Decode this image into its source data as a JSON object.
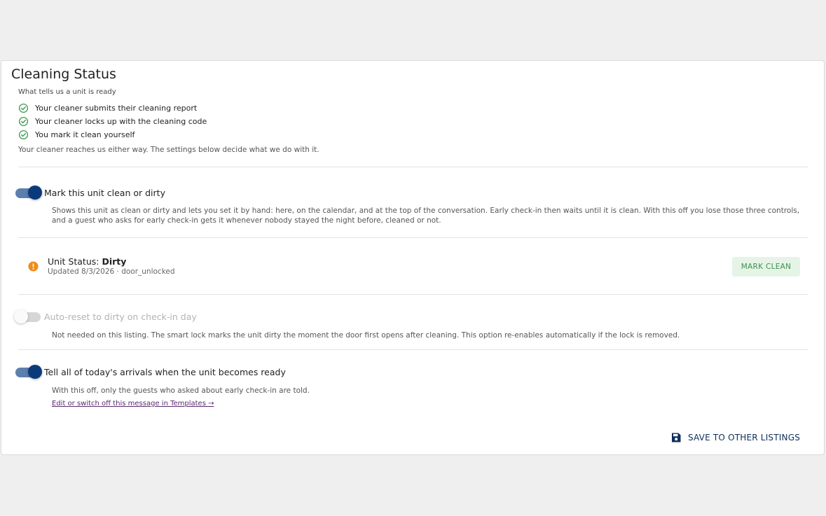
{
  "section": {
    "title": "Cleaning Status",
    "subhead": "What tells us a unit is ready",
    "checks": [
      "Your cleaner submits their cleaning report",
      "Your cleaner locks up with the cleaning code",
      "You mark it clean yourself"
    ],
    "note": "Your cleaner reaches us either way. The settings below decide what we do with it."
  },
  "toggles": {
    "mark_clean": {
      "label": "Mark this unit clean or dirty",
      "on": true,
      "description": "Shows this unit as clean or dirty and lets you set it by hand: here, on the calendar, and at the top of the conversation. Early check-in then waits until it is clean. With this off you lose those three controls, and a guest who asks for early check-in gets it whenever nobody stayed the night before, cleaned or not."
    },
    "auto_reset": {
      "label": "Auto-reset to dirty on check-in day",
      "on": false,
      "disabled": true,
      "description": "Not needed on this listing. The smart lock marks the unit dirty the moment the door first opens after cleaning. This option re-enables automatically if the lock is removed."
    },
    "tell_arrivals": {
      "label": "Tell all of today's arrivals when the unit becomes ready",
      "on": true,
      "description": "With this off, only the guests who asked about early check-in are told.",
      "link": "Edit or switch off this message in Templates →"
    }
  },
  "unit_status": {
    "prefix": "Unit Status: ",
    "value": "Dirty",
    "updated": "Updated 8/3/2026 · door_unlocked",
    "button": "MARK CLEAN"
  },
  "footer": {
    "save_label": "SAVE TO OTHER LISTINGS"
  },
  "colors": {
    "toggle_on_knob": "#0a3a7a",
    "toggle_on_track": "#5d7fae",
    "check_green": "#3f9a4f",
    "warning_orange": "#f08c1a",
    "mark_clean_bg": "#e6f4e8",
    "mark_clean_text": "#3f8f4c",
    "save_text": "#0e2f5a",
    "link": "#5a2a6e"
  },
  "icons": {
    "check": "check-circle-icon",
    "warning": "warning-circle-icon",
    "save": "floppy-disk-icon"
  }
}
